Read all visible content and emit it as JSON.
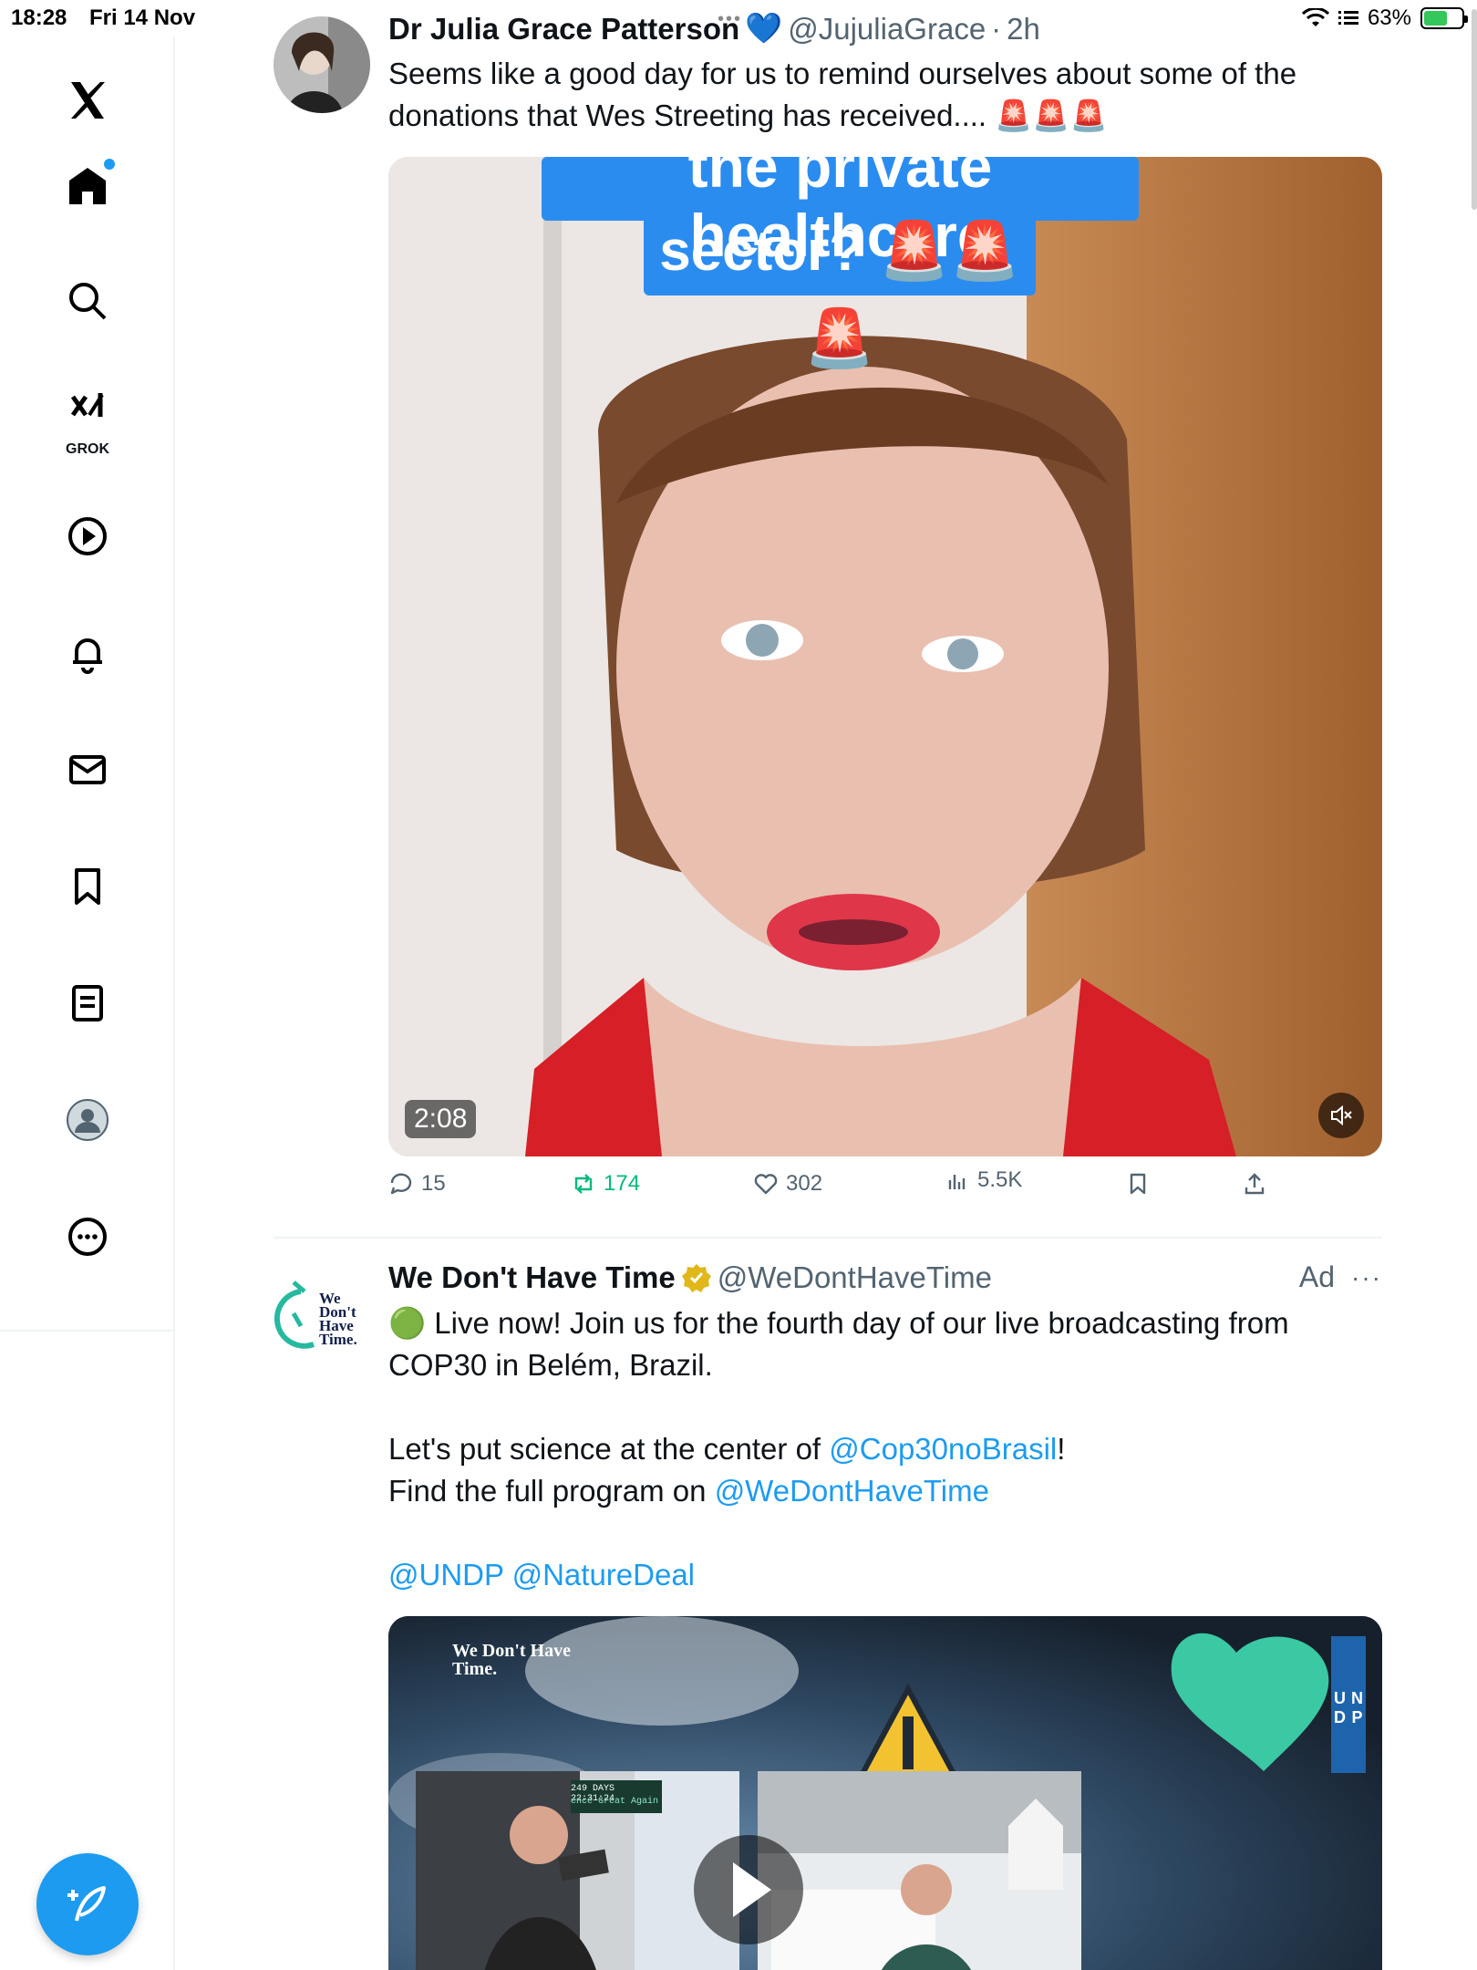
{
  "status_bar": {
    "time": "18:28",
    "date": "Fri 14 Nov",
    "battery": "63%"
  },
  "sidebar": {
    "items": [
      {
        "name": "x-logo-icon"
      },
      {
        "name": "home-icon"
      },
      {
        "name": "search-icon"
      },
      {
        "name": "grok-icon",
        "label": "GROK"
      },
      {
        "name": "video-icon"
      },
      {
        "name": "notifications-icon"
      },
      {
        "name": "messages-icon"
      },
      {
        "name": "bookmarks-icon"
      },
      {
        "name": "lists-icon"
      },
      {
        "name": "profile-icon"
      },
      {
        "name": "more-icon"
      }
    ],
    "accent_color": "#1d9bf0"
  },
  "tweets": [
    {
      "display_name": "Dr Julia Grace Patterson",
      "handle": "@JujuliaGrace",
      "dot": "·",
      "time": "2h",
      "text": "Seems like a good day for us to remind ourselves about some of the donations that Wes Streeting has received.... 🚨🚨🚨",
      "media": {
        "caption_line1": "the private healthcare",
        "caption_line2": "sector? 🚨🚨🚨",
        "duration": "2:08"
      },
      "actions": {
        "replies": "15",
        "reposts": "174",
        "likes": "302",
        "views": "5.5K"
      }
    },
    {
      "display_name": "We Don't Have Time",
      "handle": "@WeDontHaveTime",
      "ad_label": "Ad",
      "avatar_text": [
        "We",
        "Don't",
        "Have",
        "Time."
      ],
      "text_line1": "🟢 Live now! Join us for the fourth day of our live broadcasting from COP30 in Belém, Brazil.",
      "text_line2_pre": "Let's put science at the center of ",
      "text_line2_link": "@Cop30noBrasil",
      "text_line2_post": "!",
      "text_line3_pre": "Find the full program on ",
      "text_line3_link": "@WeDontHaveTime",
      "mention_1": "@UNDP",
      "mention_2": "@NatureDeal",
      "media": {
        "brand": "We Don't Have Time.",
        "undp": [
          "U",
          "N",
          "D",
          "P"
        ],
        "countdown": "249 DAYS 22:31:24",
        "banner_text": "ence Great Again"
      }
    }
  ]
}
